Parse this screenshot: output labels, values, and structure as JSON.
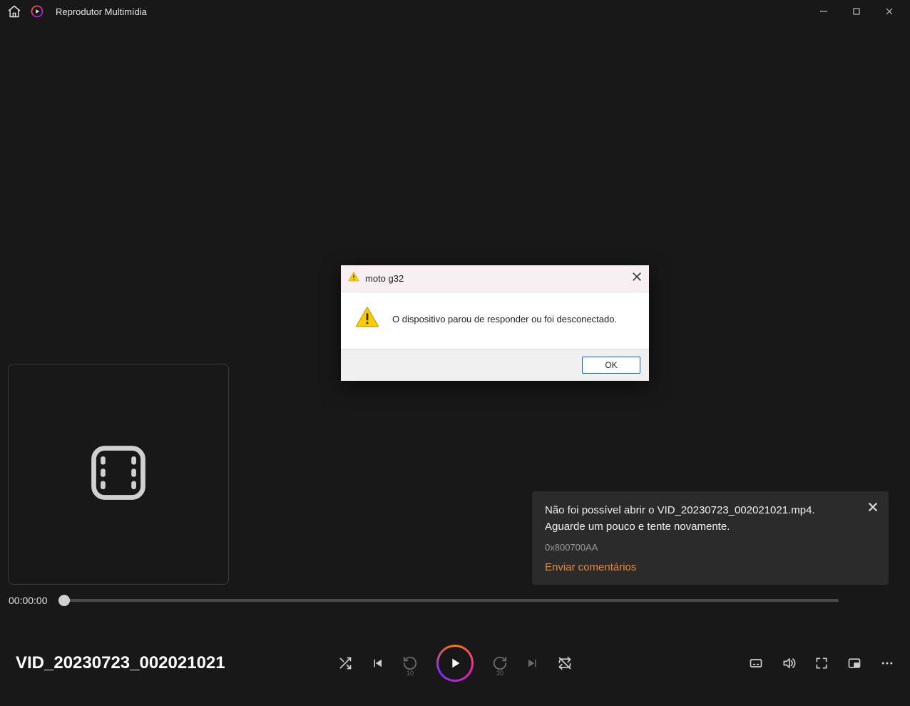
{
  "titlebar": {
    "app_name": "Reprodutor Multimídia"
  },
  "progress": {
    "current_time": "00:00:00"
  },
  "media": {
    "title": "VID_20230723_002021021"
  },
  "controls": {
    "rewind_seconds": "10",
    "forward_seconds": "30"
  },
  "toast": {
    "line1": "Não foi possível abrir o VID_20230723_002021021.mp4.",
    "line2": "Aguarde um pouco e tente novamente.",
    "error_code": "0x800700AA",
    "link": "Enviar comentários"
  },
  "dialog": {
    "title": "moto g32",
    "message": "O dispositivo parou de responder ou foi desconectado.",
    "ok_label": "OK"
  }
}
